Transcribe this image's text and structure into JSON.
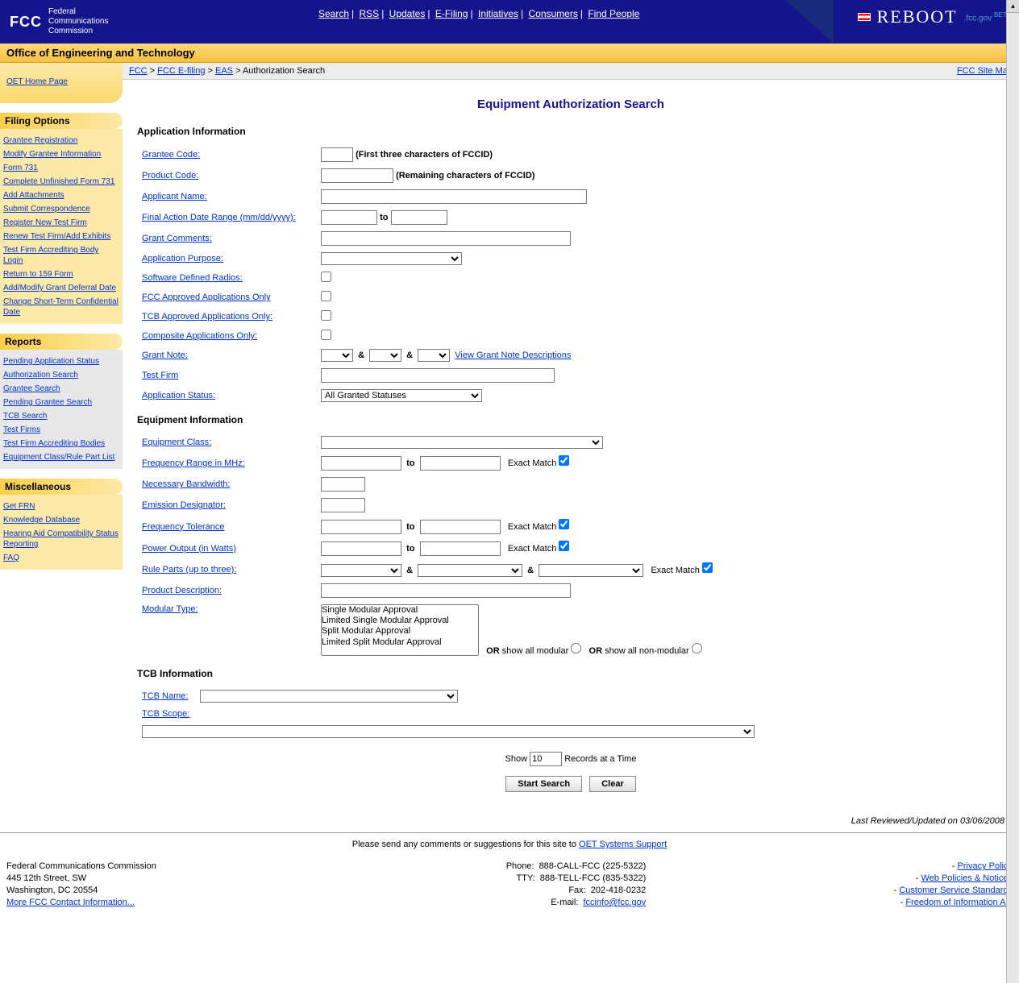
{
  "header": {
    "logo_abbrev": "FCC",
    "logo_line1": "Federal",
    "logo_line2": "Communications",
    "logo_line3": "Commission",
    "nav": [
      "Search",
      "RSS",
      "Updates",
      "E-Filing",
      "Initiatives",
      "Consumers",
      "Find People"
    ],
    "reboot_label": "REBOOT",
    "reboot_suffix": ".fcc.gov",
    "reboot_beta": "BETA"
  },
  "subheader": "Office of Engineering and Technology",
  "breadcrumb": {
    "items": [
      "FCC",
      "FCC E-filing",
      "EAS"
    ],
    "current": "Authorization Search",
    "sitemap": "FCC Site Map"
  },
  "oet_home": "OET Home Page",
  "sidebar": {
    "filing": {
      "title": "Filing Options",
      "items": [
        "Grantee Registration",
        "Modify Grantee Information",
        "Form 731",
        "Complete Unfinished Form 731",
        "Add Attachments",
        "Submit Correspondence",
        "Register New Test Firm",
        "Renew Test Firm/Add Exhibits",
        "Test Firm Accrediting Body Login",
        "Return to 159 Form",
        "Add/Modify Grant Deferral Date",
        "Change Short-Term Confidential Date"
      ]
    },
    "reports": {
      "title": "Reports",
      "items": [
        "Pending Application Status",
        "Authorization Search",
        "Grantee Search",
        "Pending Grantee Search",
        "TCB Search",
        "Test Firms",
        "Test Firm Accrediting Bodies",
        "Equipment Class/Rule Part List"
      ]
    },
    "misc": {
      "title": "Miscellaneous",
      "items": [
        "Get FRN",
        "Knowledge Database",
        "Hearing Aid Compatibility Status Reporting",
        "FAQ"
      ]
    }
  },
  "page": {
    "title": "Equipment Authorization Search",
    "app_info": {
      "title": "Application Information",
      "grantee_code": "Grantee Code:",
      "grantee_hint": "(First three characters of FCCID)",
      "product_code": "Product Code:",
      "product_hint": "(Remaining characters of FCCID)",
      "applicant_name": "Applicant Name:",
      "final_action": "Final Action Date Range (mm/dd/yyyy):",
      "to": "to",
      "grant_comments": "Grant Comments:",
      "app_purpose": "Application Purpose:",
      "sdr": "Software Defined Radios:",
      "fcc_approved": "FCC Approved Applications Only",
      "tcb_approved": "TCB Approved Applications Only:",
      "composite": "Composite Applications Only:",
      "grant_note": "Grant Note:",
      "amp": "&",
      "view_grant_notes": "View Grant Note Descriptions",
      "test_firm": "Test Firm",
      "app_status": "Application Status:",
      "app_status_value": "All Granted Statuses"
    },
    "eq_info": {
      "title": "Equipment Information",
      "eq_class": "Equipment Class:",
      "freq_range": "Frequency Range in MHz:",
      "nec_bw": "Necessary Bandwidth:",
      "emission": "Emission Designator:",
      "freq_tol": "Frequency Tolerance",
      "power_out": "Power Output (in Watts)",
      "rule_parts": "Rule Parts (up to three):",
      "prod_desc": "Product Description:",
      "mod_type": "Modular Type:",
      "mod_options": [
        "Single Modular Approval",
        "Limited Single Modular Approval",
        "Split Modular Approval",
        "Limited Split Modular Approval"
      ],
      "exact_match": "Exact Match",
      "or_all_mod": "OR show all modular",
      "or_all_nonmod": "OR show all non-modular"
    },
    "tcb_info": {
      "title": "TCB Information",
      "name": "TCB Name:",
      "scope": "TCB Scope:"
    },
    "show": "Show",
    "show_value": "10",
    "records": "Records at a Time",
    "start_search": "Start Search",
    "clear": "Clear",
    "last_reviewed": "Last Reviewed/Updated on 03/06/2008"
  },
  "footer": {
    "note_prefix": "Please send any comments or suggestions for this site to ",
    "note_link": "OET Systems Support",
    "addr_name": "Federal Communications Commission",
    "addr1": "445 12th Street, SW",
    "addr2": "Washington, DC 20554",
    "more_contact": "More FCC Contact Information...",
    "phone_lbl": "Phone:",
    "phone": "888-CALL-FCC (225-5322)",
    "tty_lbl": "TTY:",
    "tty": "888-TELL-FCC (835-5322)",
    "fax_lbl": "Fax:",
    "fax": "202-418-0232",
    "email_lbl": "E-mail:",
    "email": "fccinfo@fcc.gov",
    "right_links": [
      "Privacy Policy",
      "Web Policies & Notices",
      "Customer Service Standards",
      "Freedom of Information Act"
    ]
  }
}
